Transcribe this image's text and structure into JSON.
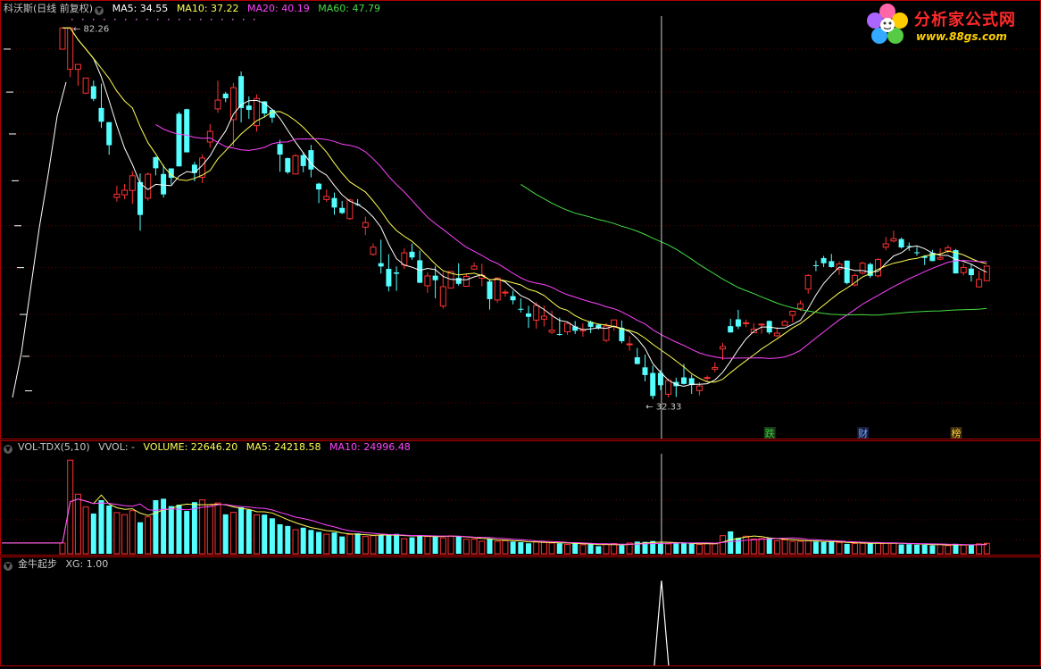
{
  "main_panel": {
    "stock_name": "科沃斯(日线 前复权)",
    "ma_labels": [
      {
        "text": "MA5: 34.55",
        "color": "#ffffff"
      },
      {
        "text": "MA10: 37.22",
        "color": "#ffff55"
      },
      {
        "text": "MA20: 40.19",
        "color": "#ff44ff"
      },
      {
        "text": "MA60: 47.79",
        "color": "#44dd44"
      }
    ],
    "high_label": "82.26",
    "low_label": "32.33",
    "markers": [
      {
        "text": "跌",
        "color": "#33cc33",
        "bg": "#1a3a1a"
      },
      {
        "text": "财",
        "color": "#66aaff",
        "bg": "#1a1a3a"
      },
      {
        "text": "榜",
        "color": "#ffcc33",
        "bg": "#3a2a10"
      }
    ]
  },
  "volume_panel": {
    "label": "VOL-TDX(5,10)",
    "vvol": "VVOL: -",
    "volume_text": "VOLUME: 22646.20",
    "ma5_text": "MA5: 24218.58",
    "ma10_text": "MA10: 24996.48"
  },
  "signal_panel": {
    "label": "金牛起步",
    "xg_text": "XG: 1.00"
  },
  "logo": {
    "title": "分析家公式网",
    "url": "www.88gs.com"
  },
  "colors": {
    "up": "#ff3333",
    "down": "#55ffff",
    "ma5": "#ffffff",
    "ma10": "#ffff55",
    "ma20": "#ff44ff",
    "ma60": "#44dd44",
    "border": "#b00000"
  },
  "chart_data": {
    "type": "candlestick",
    "y_min_reference": 32.33,
    "y_max_reference": 82.26,
    "candles_ohlc": [
      [
        77.99,
        82.26,
        77.99,
        82.26
      ],
      [
        74.13,
        82.26,
        72.66,
        82.26
      ],
      [
        74.13,
        75.05,
        71.11,
        75.05
      ],
      [
        69.82,
        72.53,
        69.68,
        72.53
      ],
      [
        71.04,
        72.07,
        68.44,
        68.81
      ],
      [
        67.26,
        71.5,
        63.95,
        64.97
      ],
      [
        64.9,
        64.9,
        59.79,
        61.24
      ],
      [
        53.7,
        55.29,
        53.13,
        54.14
      ],
      [
        54.05,
        55.54,
        53.45,
        54.68
      ],
      [
        54.65,
        57.37,
        52.85,
        56.7
      ],
      [
        55.82,
        57.05,
        49.38,
        51.38
      ],
      [
        53.59,
        57.18,
        53.27,
        56.92
      ],
      [
        59.43,
        59.52,
        56.76,
        57.79
      ],
      [
        56.96,
        58.31,
        53.68,
        54.11
      ],
      [
        57.77,
        57.77,
        55.49,
        56.41
      ],
      [
        66.29,
        66.6,
        58.06,
        58.06
      ],
      [
        67.05,
        67.15,
        60.15,
        60.15
      ],
      [
        58.32,
        58.73,
        55.92,
        57.1
      ],
      [
        56.5,
        59.82,
        55.68,
        59.3
      ],
      [
        61.73,
        64.59,
        60.86,
        63.41
      ],
      [
        67.1,
        72.03,
        66.43,
        68.6
      ],
      [
        69.73,
        70.05,
        68.24,
        68.92
      ],
      [
        65.31,
        71.63,
        61.05,
        70.79
      ],
      [
        72.87,
        73.73,
        64.84,
        67.25
      ],
      [
        67.67,
        69.25,
        65.45,
        66.93
      ],
      [
        64.34,
        69.59,
        63.38,
        68.89
      ],
      [
        68.38,
        68.45,
        65.64,
        66.33
      ],
      [
        66.93,
        66.98,
        64.81,
        65.64
      ],
      [
        61.42,
        62.09,
        57.27,
        59.81
      ],
      [
        59.28,
        59.36,
        56.97,
        57.21
      ],
      [
        56.96,
        59.88,
        56.92,
        59.64
      ],
      [
        59.73,
        60.22,
        57.2,
        58.11
      ],
      [
        60.48,
        61.28,
        56.47,
        57.6
      ],
      [
        55.59,
        55.73,
        52.93,
        54.79
      ],
      [
        53.42,
        54.78,
        53.09,
        53.83
      ],
      [
        53.62,
        54.35,
        51.4,
        52.35
      ],
      [
        52.3,
        53.23,
        51.5,
        51.63
      ],
      [
        50.91,
        53.54,
        50.74,
        53.35
      ],
      [
        52.8,
        53.47,
        52.55,
        52.77
      ],
      [
        49.83,
        51.18,
        48.85,
        50.4
      ],
      [
        46.53,
        47.82,
        46.36,
        47.38
      ],
      [
        45.51,
        48.28,
        44.34,
        45.13
      ],
      [
        44.86,
        46.56,
        42.39,
        42.93
      ],
      [
        44.47,
        45.14,
        42.45,
        44.31
      ],
      [
        45.3,
        47.23,
        44.83,
        46.71
      ],
      [
        46.84,
        47.8,
        45.89,
        46.17
      ],
      [
        45.84,
        46.98,
        43.28,
        43.32
      ],
      [
        42.99,
        44.48,
        42.23,
        44.07
      ],
      [
        44.1,
        45.18,
        41.66,
        43.6
      ],
      [
        40.85,
        44.53,
        40.59,
        42.89
      ],
      [
        42.75,
        44.62,
        42.7,
        44.56
      ],
      [
        43.85,
        45.5,
        43.01,
        43.2
      ],
      [
        42.94,
        44.31,
        42.93,
        44.01
      ],
      [
        44.83,
        45.6,
        44.77,
        45.17
      ],
      [
        43.82,
        45.44,
        42.94,
        44.13
      ],
      [
        43.46,
        43.58,
        40.49,
        41.57
      ],
      [
        41.48,
        43.84,
        41.2,
        43.84
      ],
      [
        42.22,
        42.58,
        41.82,
        42.31
      ],
      [
        41.89,
        42.46,
        41.03,
        41.45
      ],
      [
        40.57,
        41.65,
        40.18,
        40.55
      ],
      [
        40.1,
        40.88,
        38.66,
        39.76
      ],
      [
        39.43,
        41.26,
        38.6,
        40.91
      ],
      [
        39.53,
        40.9,
        38.81,
        39.82
      ],
      [
        38.26,
        40.38,
        38.07,
        38.45
      ],
      [
        38.07,
        39.69,
        37.92,
        38.02
      ],
      [
        38.29,
        39.26,
        38.0,
        39.11
      ],
      [
        38.81,
        39.34,
        38.08,
        38.39
      ],
      [
        38.39,
        39.11,
        37.81,
        38.51
      ],
      [
        39.26,
        39.39,
        38.16,
        38.77
      ],
      [
        38.98,
        39.08,
        38.51,
        38.62
      ],
      [
        37.48,
        39.12,
        37.3,
        38.85
      ],
      [
        38.78,
        39.47,
        38.38,
        39.45
      ],
      [
        38.68,
        39.4,
        37.2,
        37.4
      ],
      [
        37.09,
        37.88,
        36.52,
        37.14
      ],
      [
        35.91,
        36.76,
        35.26,
        35.31
      ],
      [
        35.01,
        36.14,
        33.8,
        34.34
      ],
      [
        34.52,
        35.17,
        32.33,
        32.58
      ],
      [
        34.53,
        34.77,
        33.06,
        33.47
      ],
      [
        32.72,
        34.02,
        32.47,
        33.87
      ],
      [
        33.75,
        34.11,
        32.49,
        33.39
      ],
      [
        34.14,
        35.31,
        33.53,
        33.58
      ],
      [
        34.07,
        34.38,
        32.75,
        33.49
      ],
      [
        33.02,
        33.72,
        32.62,
        33.41
      ],
      [
        34.07,
        34.3,
        33.74,
        34.13
      ],
      [
        34.85,
        35.46,
        34.6,
        34.99
      ],
      [
        36.67,
        37.24,
        35.67,
        36.89
      ],
      [
        38.84,
        39.57,
        38.2,
        38.23
      ],
      [
        39.51,
        40.47,
        38.55,
        38.8
      ],
      [
        39.17,
        39.49,
        38.74,
        39.17
      ],
      [
        38.2,
        39.14,
        38.16,
        38.55
      ],
      [
        38.98,
        39.1,
        38.12,
        39.04
      ],
      [
        39.35,
        39.4,
        38.05,
        38.23
      ],
      [
        37.91,
        38.72,
        37.79,
        38.16
      ],
      [
        38.92,
        39.45,
        38.91,
        39.29
      ],
      [
        39.92,
        40.37,
        39.24,
        40.32
      ],
      [
        40.61,
        41.43,
        40.38,
        41.09
      ],
      [
        42.64,
        44.28,
        42.14,
        44.12
      ],
      [
        45.27,
        45.81,
        44.6,
        45.17
      ],
      [
        46.1,
        46.35,
        45.07,
        45.5
      ],
      [
        45.74,
        46.58,
        45.01,
        45.06
      ],
      [
        44.84,
        45.71,
        44.18,
        45.41
      ],
      [
        45.8,
        45.82,
        43.15,
        43.29
      ],
      [
        43.08,
        44.35,
        42.93,
        44.12
      ],
      [
        44.39,
        45.68,
        44.22,
        45.5
      ],
      [
        45.4,
        45.57,
        43.85,
        44.08
      ],
      [
        44.08,
        46.06,
        43.93,
        45.93
      ],
      [
        47.38,
        48.62,
        47.02,
        47.78
      ],
      [
        48.13,
        49.4,
        47.95,
        48.4
      ],
      [
        48.35,
        48.54,
        47.21,
        47.35
      ],
      [
        47.52,
        47.94,
        46.95,
        47.46
      ],
      [
        46.77,
        47.44,
        46.38,
        46.68
      ],
      [
        46.31,
        46.43,
        45.29,
        46.12
      ],
      [
        46.7,
        47.06,
        45.75,
        45.75
      ],
      [
        45.97,
        47.24,
        45.82,
        46.17
      ],
      [
        46.96,
        47.61,
        46.62,
        47.31
      ],
      [
        47.03,
        47.16,
        44.35,
        44.35
      ],
      [
        44.44,
        45.52,
        44.12,
        45.02
      ],
      [
        44.89,
        45.39,
        43.46,
        44.16
      ],
      [
        42.87,
        44.67,
        42.81,
        43.68
      ],
      [
        43.54,
        45.21,
        43.53,
        45.17
      ]
    ],
    "volume": [
      3.8,
      33.0,
      21.0,
      16.5,
      14.2,
      18.9,
      17.0,
      14.5,
      13.8,
      15.2,
      11.1,
      13.0,
      18.9,
      19.4,
      16.8,
      17.3,
      15.1,
      18.2,
      19.0,
      17.2,
      17.9,
      13.9,
      14.6,
      16.4,
      15.5,
      13.7,
      13.8,
      12.5,
      10.4,
      9.8,
      8.5,
      9.2,
      8.4,
      7.7,
      6.9,
      7.5,
      6.1,
      6.8,
      7.2,
      6.1,
      6.4,
      6.6,
      6.8,
      7.0,
      5.3,
      5.8,
      6.6,
      6.1,
      6.4,
      5.6,
      6.3,
      6.3,
      5.1,
      5.2,
      4.4,
      5.3,
      4.4,
      4.6,
      4.3,
      4.1,
      3.7,
      4.2,
      4.0,
      3.8,
      3.7,
      3.3,
      3.8,
      3.2,
      3.3,
      2.7,
      3.3,
      3.6,
      3.0,
      3.8,
      4.3,
      4.2,
      4.5,
      3.8,
      3.5,
      3.7,
      3.7,
      3.6,
      3.3,
      3.7,
      3.5,
      6.4,
      7.9,
      5.6,
      6.2,
      5.2,
      5.4,
      5.5,
      4.6,
      4.9,
      4.4,
      4.4,
      4.6,
      4.3,
      4.1,
      4.4,
      3.9,
      3.5,
      3.6,
      3.7,
      3.7,
      3.9,
      3.7,
      3.8,
      3.3,
      3.4,
      3.2,
      3.2,
      3.0,
      3.3,
      2.9,
      3.5,
      3.1,
      3.0,
      3.5,
      3.7
    ],
    "ma60_start_index": 59,
    "signal_index": 77,
    "marker_indices": [
      91,
      103,
      115
    ],
    "xg_value": 1.0
  }
}
